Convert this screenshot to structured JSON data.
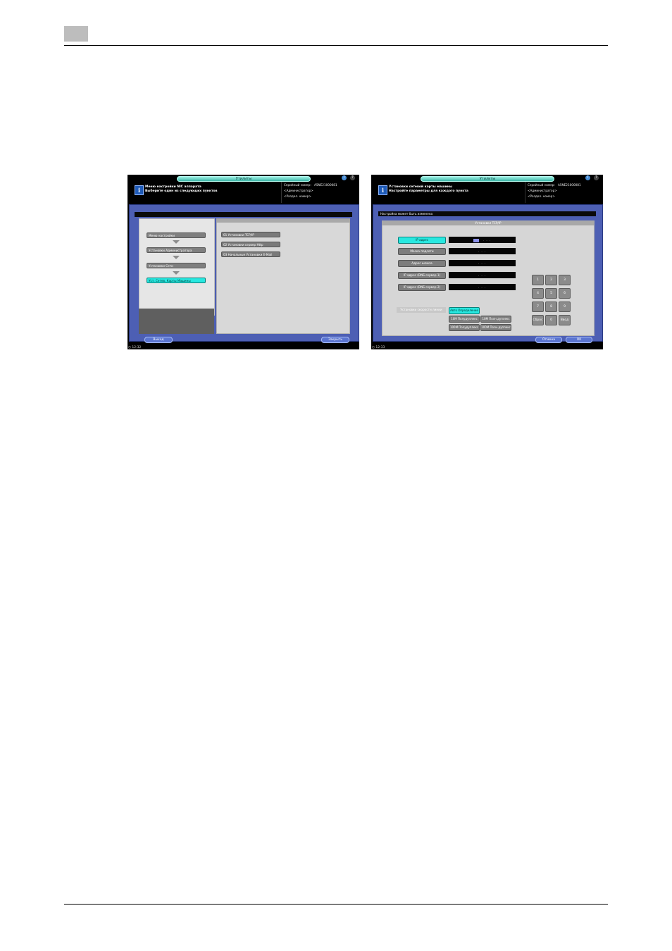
{
  "screens": [
    {
      "title": "Утилиты",
      "message": [
        "Меню настройки NIC аппарата",
        "Выберите один из следующих пунктов"
      ],
      "serial_label": "Серийный номер:",
      "serial_value": "A5NE21000081",
      "user": "<Администратор>",
      "section": "<Раздел. номер>",
      "flow_items": [
        "Меню настройки",
        "Установки Администратора",
        "Установки Сети",
        "Уст. Сетев. Карты Машины"
      ],
      "menu_items": [
        "01 Установки TCP/IP",
        "02 Установки сервер Http",
        "03 Начальные Установки E-Mail"
      ],
      "exit_button": "Выход",
      "close_button": "Закрыть",
      "clock": "12:32"
    },
    {
      "title": "Утилиты",
      "message": [
        "Установки сетевой карты машины",
        "Настройте параметры для каждого пункта"
      ],
      "serial_label": "Серийный номер:",
      "serial_value": "A5NE21000081",
      "user": "<Администратор>",
      "section": "<Раздел. номер>",
      "notice": "Настройка может быть изменена",
      "panel_title": "Установки TCP/IP",
      "fields": [
        {
          "label": "IP адрес",
          "value": ".   .   ."
        },
        {
          "label": "Маска подсети",
          "value": ".   .   ."
        },
        {
          "label": "Адрес шлюза",
          "value": ".   .   ."
        },
        {
          "label": "IP адрес (DNS сервер 1)",
          "value": ".   .   ."
        },
        {
          "label": "IP адрес (DNS сервер 2)",
          "value": ".   .   ."
        }
      ],
      "keypad": [
        "1",
        "2",
        "3",
        "4",
        "5",
        "6",
        "7",
        "8",
        "9",
        "Сброс",
        "0",
        "Ввод"
      ],
      "speed_label": "Установки скорости линии",
      "speed_options": [
        "Авто Определение",
        "10M Полудуплекс",
        "10M Полн.дуплекс",
        "100M Полудуплекс",
        "100M Полн.дуплекс"
      ],
      "cancel_button": "Отмена",
      "ok_button": "OK",
      "clock": "12:33"
    }
  ]
}
